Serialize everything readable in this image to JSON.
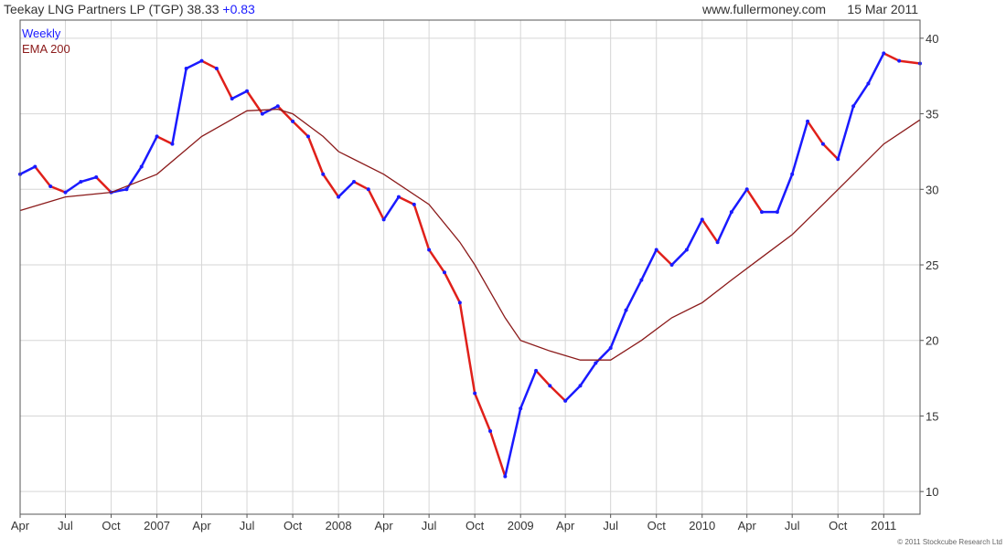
{
  "header": {
    "ticker": "Teekay LNG Partners LP (TGP)",
    "price": "38.33",
    "change": "+0.83",
    "site": "www.fullermoney.com",
    "date": "15 Mar 2011"
  },
  "footer": {
    "copyright": "© 2011 Stockcube Research Ltd"
  },
  "colors": {
    "up": "#1a1aff",
    "down": "#e0201a",
    "ema": "#8b1a1a",
    "grid": "#d6d6d6",
    "frame": "#555555",
    "weekly_label": "#1a1aff"
  },
  "chart_data": {
    "type": "line",
    "title": "Teekay LNG Partners LP (TGP)",
    "frequency_label": "Weekly",
    "ylim": [
      8.5,
      41.2
    ],
    "yticks": [
      10,
      15,
      20,
      25,
      30,
      35,
      40
    ],
    "y_axis_position": "right",
    "grid": true,
    "legend_position": "top-left",
    "x_range": [
      "2006-04-01",
      "2011-03-15"
    ],
    "x_ticks": [
      {
        "label": "Apr",
        "date": "2006-04-01"
      },
      {
        "label": "Jul",
        "date": "2006-07-01"
      },
      {
        "label": "Oct",
        "date": "2006-10-01"
      },
      {
        "label": "2007",
        "date": "2007-01-01"
      },
      {
        "label": "Apr",
        "date": "2007-04-01"
      },
      {
        "label": "Jul",
        "date": "2007-07-01"
      },
      {
        "label": "Oct",
        "date": "2007-10-01"
      },
      {
        "label": "2008",
        "date": "2008-01-01"
      },
      {
        "label": "Apr",
        "date": "2008-04-01"
      },
      {
        "label": "Jul",
        "date": "2008-07-01"
      },
      {
        "label": "Oct",
        "date": "2008-10-01"
      },
      {
        "label": "2009",
        "date": "2009-01-01"
      },
      {
        "label": "Apr",
        "date": "2009-04-01"
      },
      {
        "label": "Jul",
        "date": "2009-07-01"
      },
      {
        "label": "Oct",
        "date": "2009-10-01"
      },
      {
        "label": "2010",
        "date": "2010-01-01"
      },
      {
        "label": "Apr",
        "date": "2010-04-01"
      },
      {
        "label": "Jul",
        "date": "2010-07-01"
      },
      {
        "label": "Oct",
        "date": "2010-10-01"
      },
      {
        "label": "2011",
        "date": "2011-01-01"
      }
    ],
    "series": [
      {
        "name": "Weekly",
        "type": "line",
        "points": [
          [
            "2006-04-01",
            31.0
          ],
          [
            "2006-05-01",
            31.5
          ],
          [
            "2006-06-01",
            30.2
          ],
          [
            "2006-07-01",
            29.8
          ],
          [
            "2006-08-01",
            30.5
          ],
          [
            "2006-09-01",
            30.8
          ],
          [
            "2006-10-01",
            29.8
          ],
          [
            "2006-11-01",
            30.0
          ],
          [
            "2006-12-01",
            31.5
          ],
          [
            "2007-01-01",
            33.5
          ],
          [
            "2007-02-01",
            33.0
          ],
          [
            "2007-03-01",
            38.0
          ],
          [
            "2007-04-01",
            38.5
          ],
          [
            "2007-05-01",
            38.0
          ],
          [
            "2007-06-01",
            36.0
          ],
          [
            "2007-07-01",
            36.5
          ],
          [
            "2007-08-01",
            35.0
          ],
          [
            "2007-09-01",
            35.5
          ],
          [
            "2007-10-01",
            34.5
          ],
          [
            "2007-11-01",
            33.5
          ],
          [
            "2007-12-01",
            31.0
          ],
          [
            "2008-01-01",
            29.5
          ],
          [
            "2008-02-01",
            30.5
          ],
          [
            "2008-03-01",
            30.0
          ],
          [
            "2008-04-01",
            28.0
          ],
          [
            "2008-05-01",
            29.5
          ],
          [
            "2008-06-01",
            29.0
          ],
          [
            "2008-07-01",
            26.0
          ],
          [
            "2008-08-01",
            24.5
          ],
          [
            "2008-09-01",
            22.5
          ],
          [
            "2008-10-01",
            16.5
          ],
          [
            "2008-11-01",
            14.0
          ],
          [
            "2008-12-01",
            11.0
          ],
          [
            "2009-01-01",
            15.5
          ],
          [
            "2009-02-01",
            18.0
          ],
          [
            "2009-03-01",
            17.0
          ],
          [
            "2009-04-01",
            16.0
          ],
          [
            "2009-05-01",
            17.0
          ],
          [
            "2009-06-01",
            18.5
          ],
          [
            "2009-07-01",
            19.5
          ],
          [
            "2009-08-01",
            22.0
          ],
          [
            "2009-09-01",
            24.0
          ],
          [
            "2009-10-01",
            26.0
          ],
          [
            "2009-11-01",
            25.0
          ],
          [
            "2009-12-01",
            26.0
          ],
          [
            "2010-01-01",
            28.0
          ],
          [
            "2010-02-01",
            26.5
          ],
          [
            "2010-03-01",
            28.5
          ],
          [
            "2010-04-01",
            30.0
          ],
          [
            "2010-05-01",
            28.5
          ],
          [
            "2010-06-01",
            28.5
          ],
          [
            "2010-07-01",
            31.0
          ],
          [
            "2010-08-01",
            34.5
          ],
          [
            "2010-09-01",
            33.0
          ],
          [
            "2010-10-01",
            32.0
          ],
          [
            "2010-11-01",
            35.5
          ],
          [
            "2010-12-01",
            37.0
          ],
          [
            "2011-01-01",
            39.0
          ],
          [
            "2011-02-01",
            38.5
          ],
          [
            "2011-03-15",
            38.33
          ]
        ]
      },
      {
        "name": "EMA 200",
        "type": "line",
        "points": [
          [
            "2006-04-01",
            28.6
          ],
          [
            "2006-07-01",
            29.5
          ],
          [
            "2006-10-01",
            29.8
          ],
          [
            "2007-01-01",
            31.0
          ],
          [
            "2007-04-01",
            33.5
          ],
          [
            "2007-07-01",
            35.2
          ],
          [
            "2007-09-01",
            35.3
          ],
          [
            "2007-10-01",
            35.0
          ],
          [
            "2007-12-01",
            33.5
          ],
          [
            "2008-01-01",
            32.5
          ],
          [
            "2008-04-01",
            31.0
          ],
          [
            "2008-07-01",
            29.0
          ],
          [
            "2008-09-01",
            26.5
          ],
          [
            "2008-10-01",
            25.0
          ],
          [
            "2008-12-01",
            21.5
          ],
          [
            "2009-01-01",
            20.0
          ],
          [
            "2009-03-01",
            19.3
          ],
          [
            "2009-05-01",
            18.7
          ],
          [
            "2009-07-01",
            18.7
          ],
          [
            "2009-09-01",
            20.0
          ],
          [
            "2009-11-01",
            21.5
          ],
          [
            "2010-01-01",
            22.5
          ],
          [
            "2010-03-01",
            24.0
          ],
          [
            "2010-05-01",
            25.5
          ],
          [
            "2010-07-01",
            27.0
          ],
          [
            "2010-09-01",
            29.0
          ],
          [
            "2010-11-01",
            31.0
          ],
          [
            "2011-01-01",
            33.0
          ],
          [
            "2011-03-15",
            34.6
          ]
        ]
      }
    ]
  }
}
